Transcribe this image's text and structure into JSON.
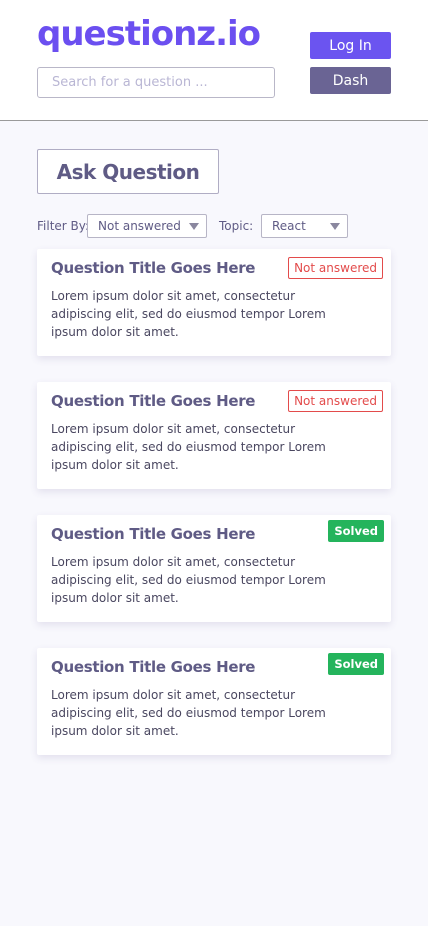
{
  "header": {
    "logo": "questionz.io",
    "search_placeholder": "Search for a question ...",
    "login_label": "Log In",
    "dash_label": "Dash"
  },
  "actions": {
    "ask_label": "Ask Question"
  },
  "filters": {
    "filter_label": "Filter By:",
    "filter_value": "Not answered",
    "topic_label": "Topic:",
    "topic_value": "React"
  },
  "colors": {
    "brand": "#6b4ff0",
    "dash": "#6a6494",
    "not_answered": "#e34b4b",
    "solved": "#24b45c"
  },
  "questions": [
    {
      "title": "Question Title Goes Here",
      "status": "Not answered",
      "body": "Lorem ipsum dolor sit amet, consectetur adipiscing elit, sed do eiusmod tempor Lorem ipsum dolor sit amet."
    },
    {
      "title": "Question Title Goes Here",
      "status": "Not answered",
      "body": "Lorem ipsum dolor sit amet, consectetur adipiscing elit, sed do eiusmod tempor Lorem ipsum dolor sit amet."
    },
    {
      "title": "Question Title Goes Here",
      "status": "Solved",
      "body": "Lorem ipsum dolor sit amet, consectetur adipiscing elit, sed do eiusmod tempor Lorem ipsum dolor sit amet."
    },
    {
      "title": "Question Title Goes Here",
      "status": "Solved",
      "body": "Lorem ipsum dolor sit amet, consectetur adipiscing elit, sed do eiusmod tempor Lorem ipsum dolor sit amet."
    }
  ]
}
